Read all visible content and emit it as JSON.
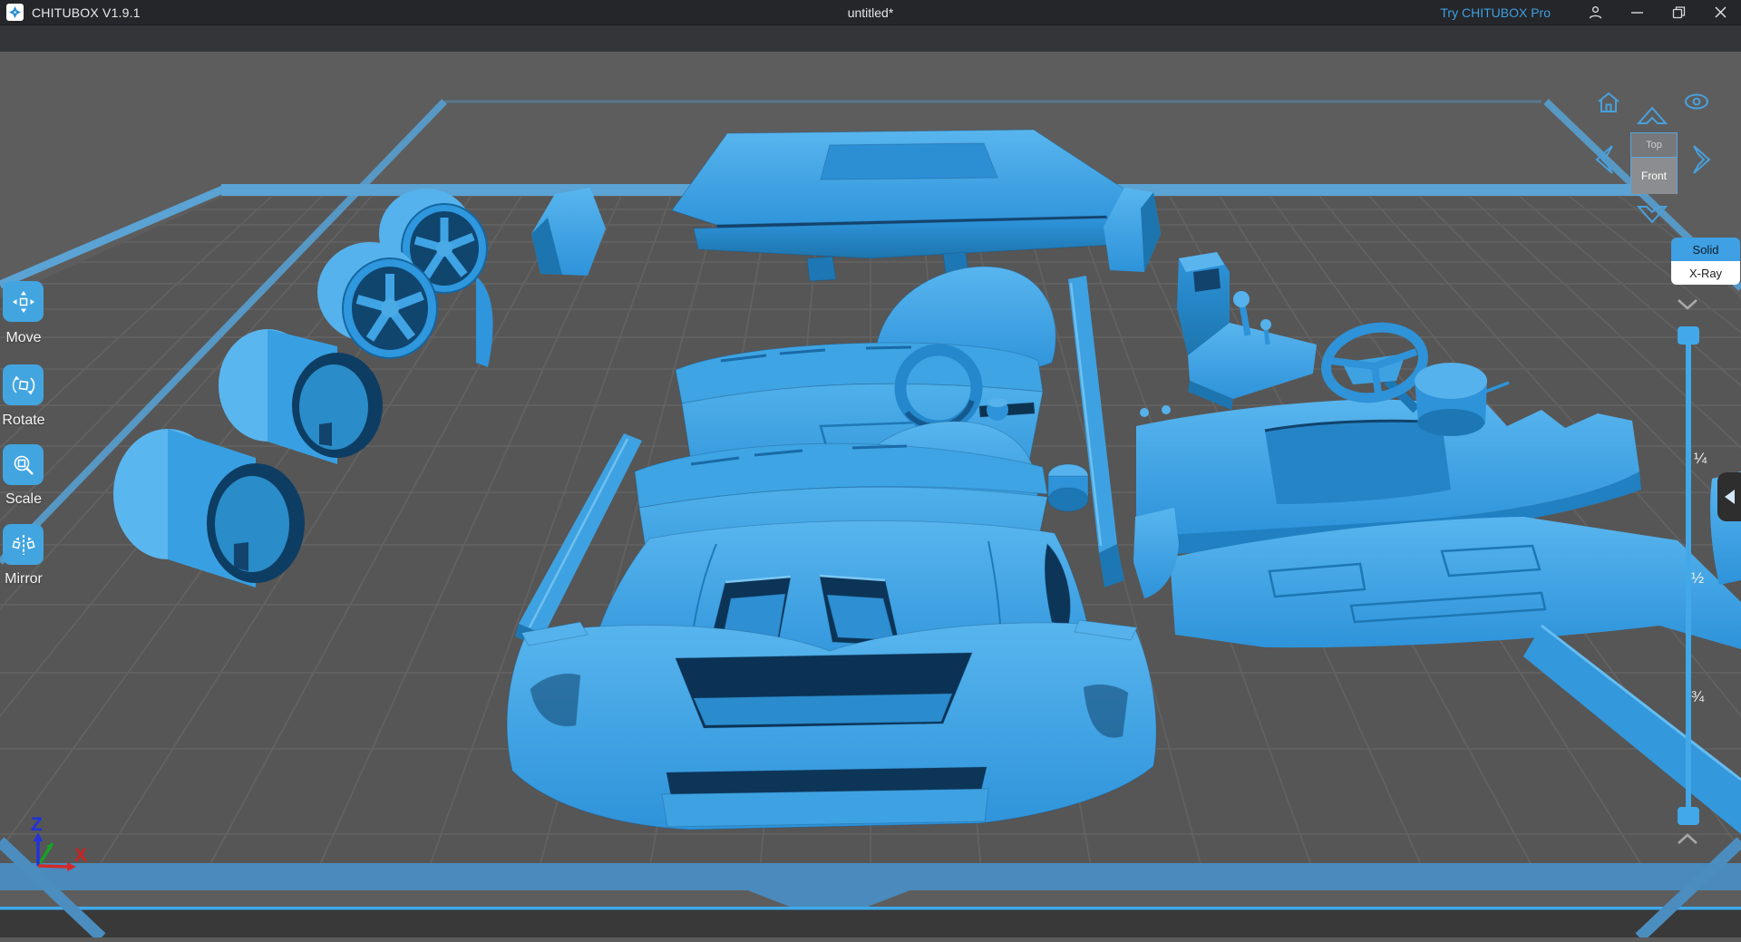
{
  "window": {
    "app_title": "CHITUBOX V1.9.1",
    "document_title": "untitled*",
    "pro_link": "Try CHITUBOX Pro"
  },
  "toolbar": {
    "buttons": [
      {
        "id": "open",
        "icon": "folder-open-icon"
      },
      {
        "id": "save",
        "icon": "floppy-save-icon"
      },
      {
        "id": "plate",
        "icon": "build-plate-icon"
      },
      {
        "id": "undo",
        "icon": "arrow-undo-icon"
      },
      {
        "id": "redo",
        "icon": "arrow-redo-icon"
      },
      {
        "id": "file-info",
        "icon": "document-list-icon"
      },
      {
        "id": "arrange",
        "icon": "cubes-arrange-icon"
      },
      {
        "id": "resin",
        "icon": "resin-bottle-icon"
      },
      {
        "id": "detect",
        "icon": "detect-region-icon"
      },
      {
        "id": "slice",
        "icon": "slice-tank-icon"
      }
    ]
  },
  "tools": [
    {
      "label": "Move"
    },
    {
      "label": "Rotate"
    },
    {
      "label": "Scale"
    },
    {
      "label": "Mirror"
    }
  ],
  "view_cube": {
    "top_face": "Top",
    "front_face": "Front"
  },
  "render_modes": {
    "solid": "Solid",
    "xray": "X-Ray",
    "active": "Solid"
  },
  "layer_slider": {
    "marks": [
      "¼",
      "½",
      "¾"
    ]
  },
  "axes": {
    "z": "Z",
    "x": "X"
  },
  "colors": {
    "accent_blue": "#42a3e0",
    "toolbar_button_blue": "#4aa0dc",
    "model_blue": "#2e95dc",
    "plate_edge_blue": "#5aa3d4",
    "front_band_blue": "#4a8abc",
    "viewport_gray": "#5c5c5c"
  }
}
